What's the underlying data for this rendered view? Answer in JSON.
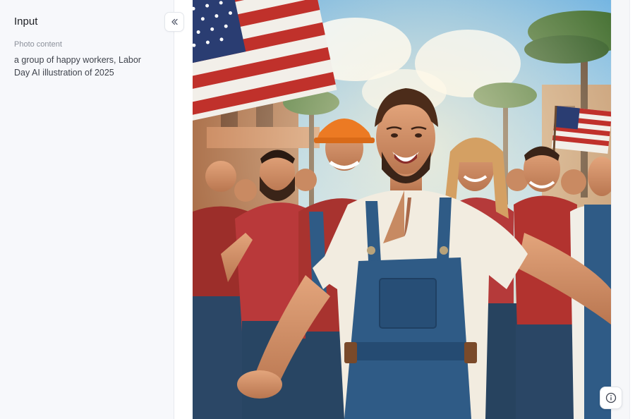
{
  "panel": {
    "title": "Input",
    "collapse_icon": "chevrons-left-icon",
    "prompt_label": "Photo content",
    "prompt_value": "a group of happy workers, Labor Day AI illustration of 2025"
  },
  "viewer": {
    "image_description": "Generated illustration: cheering workers in overalls, hard hat and red shirts with American flags and palm trees",
    "info_icon": "info-icon"
  },
  "colors": {
    "sidebar_bg": "#f7f8fb",
    "text_primary": "#1d1f24",
    "text_muted": "#8b909a",
    "sky": "#8fc3e6",
    "shirt_red": "#b23a34",
    "denim": "#2f5b86"
  }
}
